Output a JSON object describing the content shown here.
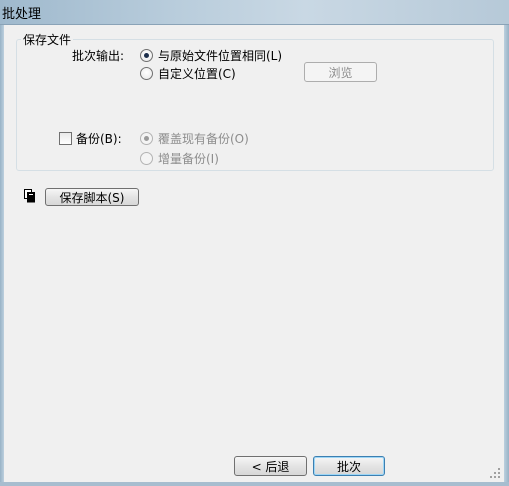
{
  "window": {
    "title": "批处理"
  },
  "save_file": {
    "legend": "保存文件",
    "batch_output_label": "批次输出:",
    "option_same_location": "与原始文件位置相同(L)",
    "option_custom_location": "自定义位置(C)",
    "browse_label": "浏览",
    "backup_label": "备份(B):",
    "option_overwrite_backup": "覆盖现有备份(O)",
    "option_incremental_backup": "增量备份(I)"
  },
  "script": {
    "save_script_label": "保存脚本(S)"
  },
  "footer": {
    "back_label": "< 后退",
    "batch_label": "批次"
  },
  "colors": {
    "titlebar": "#b9cddc",
    "dialog_bg": "#f0f0f0",
    "default_button_border": "#3c7fb1"
  }
}
